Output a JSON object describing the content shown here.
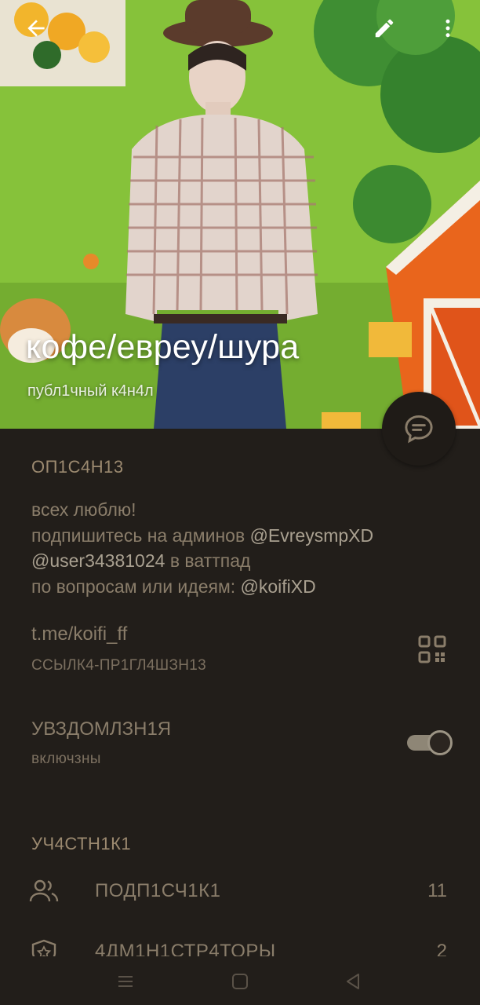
{
  "header": {
    "title": "кофе/евреу/шура",
    "subtitle": "публ1чный к4н4л",
    "back_icon": "arrow-left-icon",
    "edit_icon": "pencil-icon",
    "menu_icon": "more-vertical-icon"
  },
  "fab": {
    "icon": "chat-bubble-icon"
  },
  "description": {
    "section_title": "ОП1С4Н13",
    "line1": "всех люблю!",
    "line2_text": "подпишитесь на админов ",
    "line2_mention": "@EvreysmpXD",
    "line3_mention": "@user34381024",
    "line3_text": " в ваттпад",
    "line4_text": "по вопросам или идеям: ",
    "line4_mention": "@koifiXD"
  },
  "link": {
    "value": "t.me/koifi_ff",
    "label": "ССЫЛК4-ПР1ГЛ4ШЗН13",
    "qr_icon": "qr-code-icon"
  },
  "notifications": {
    "title": "УВЗДОМЛЗН1Я",
    "status": "включзны",
    "enabled": true
  },
  "members": {
    "section_title": "УЧ4СТН1К1",
    "items": [
      {
        "label": "ПОДП1СЧ1К1",
        "count": "11",
        "icon": "people-icon"
      },
      {
        "label": "4ДМ1Н1СТР4ТОРЫ",
        "count": "2",
        "icon": "admin-shield-icon"
      }
    ]
  },
  "navbar": {
    "menu_icon": "recent-apps-icon",
    "home_icon": "home-icon",
    "back_icon": "back-triangle-icon"
  },
  "colors": {
    "background": "#221e1a",
    "text_primary": "#8a7d6a",
    "section_title": "#9c8a70",
    "cover_green": "#8cc63a"
  }
}
